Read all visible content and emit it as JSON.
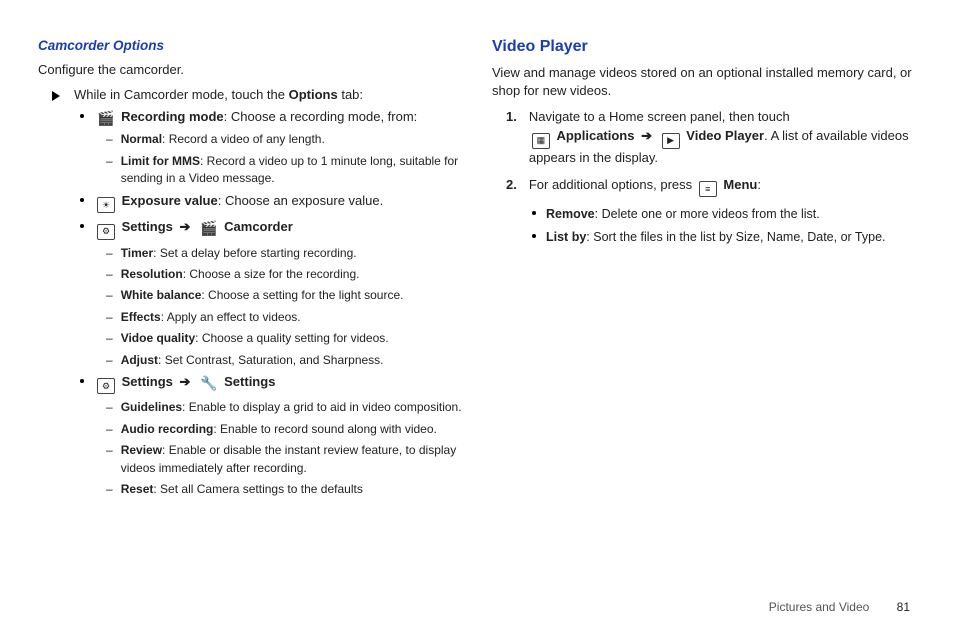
{
  "left": {
    "heading": "Camcorder Options",
    "intro": "Configure the camcorder.",
    "step_prefix": "While in Camcorder mode, touch the ",
    "step_bold": "Options",
    "step_suffix": " tab:",
    "b1": {
      "label": "Recording mode",
      "desc": ": Choose a recording mode, from:",
      "d1l": "Normal",
      "d1d": ": Record a video of any length.",
      "d2l": "Limit for MMS",
      "d2d": ": Record a video up to 1 minute long, suitable for sending in a Video message."
    },
    "b2": {
      "label": "Exposure value",
      "desc": ": Choose an exposure value."
    },
    "b3": {
      "s1": "Settings",
      "arrow": "➔",
      "s2": "Camcorder",
      "d1l": "Timer",
      "d1d": ": Set a delay before starting recording.",
      "d2l": "Resolution",
      "d2d": ": Choose a size for the recording.",
      "d3l": "White balance",
      "d3d": ": Choose a setting for the light source.",
      "d4l": "Effects",
      "d4d": ": Apply an effect to videos.",
      "d5l": "Vidoe quality",
      "d5d": ": Choose a quality setting for videos.",
      "d6l": "Adjust",
      "d6d": ": Set Contrast, Saturation, and Sharpness."
    },
    "b4": {
      "s1": "Settings",
      "arrow": "➔",
      "s2": "Settings",
      "d1l": "Guidelines",
      "d1d": ": Enable to display a grid to aid in video composition.",
      "d2l": "Audio recording",
      "d2d": ": Enable to record sound along with video.",
      "d3l": "Review",
      "d3d": ": Enable or disable the instant review feature, to display videos immediately after recording.",
      "d4l": "Reset",
      "d4d": ": Set all Camera settings to the defaults"
    }
  },
  "right": {
    "heading": "Video Player",
    "intro": "View and manage videos stored on an optional installed memory card, or shop for new videos.",
    "n1": {
      "num": "1.",
      "t1": "Navigate to a Home screen panel, then touch ",
      "apps": "Applications",
      "arrow": "➔",
      "vp": "Video Player",
      "t2": ". A list of available videos appears in the display."
    },
    "n2": {
      "num": "2.",
      "t1": "For additional options, press ",
      "menu": "Menu",
      "t2": ":"
    },
    "b1l": "Remove",
    "b1d": ": Delete one or more videos from the list.",
    "b2l": "List by",
    "b2d": ": Sort the files in the list by Size, Name, Date, or Type."
  },
  "footer": {
    "section": "Pictures and Video",
    "page": "81"
  }
}
